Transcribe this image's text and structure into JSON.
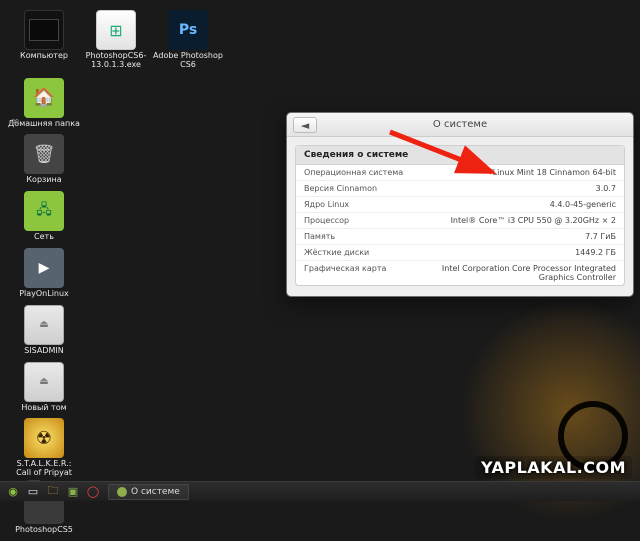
{
  "desktop_icons": {
    "computer": "Компьютер",
    "photoshop_exe": "PhotoshopCS6-13.0.1.3.exe",
    "photoshop_cs6": "Adobe Photoshop CS6",
    "home_folder": "Домашняя папка",
    "trash": "Корзина",
    "network": "Сеть",
    "playonlinux": "PlayOnLinux",
    "sisadmin": "SISADMIN",
    "new_volume": "Новый том",
    "stalker": "S.T.A.L.K.E.R.: Call of Pripyat",
    "photoshop_cs5": "PhotoshopCS5"
  },
  "window": {
    "title": "О системе",
    "panel_title": "Сведения о системе",
    "rows": [
      {
        "k": "Операционная система",
        "v": "Linux Mint 18 Cinnamon 64-bit"
      },
      {
        "k": "Версия Cinnamon",
        "v": "3.0.7"
      },
      {
        "k": "Ядро Linux",
        "v": "4.4.0-45-generic"
      },
      {
        "k": "Процессор",
        "v": "Intel® Core™ i3 CPU    550  @ 3.20GHz × 2"
      },
      {
        "k": "Память",
        "v": "7.7 ГиБ"
      },
      {
        "k": "Жёсткие диски",
        "v": "1449.2 ГБ"
      },
      {
        "k": "Графическая карта",
        "v": "Intel Corporation Core Processor Integrated Graphics Controller"
      }
    ]
  },
  "taskbar": {
    "task_label": "О системе"
  },
  "watermark": "YAPLAKAL.COM",
  "ps_icon_text": "Ps"
}
